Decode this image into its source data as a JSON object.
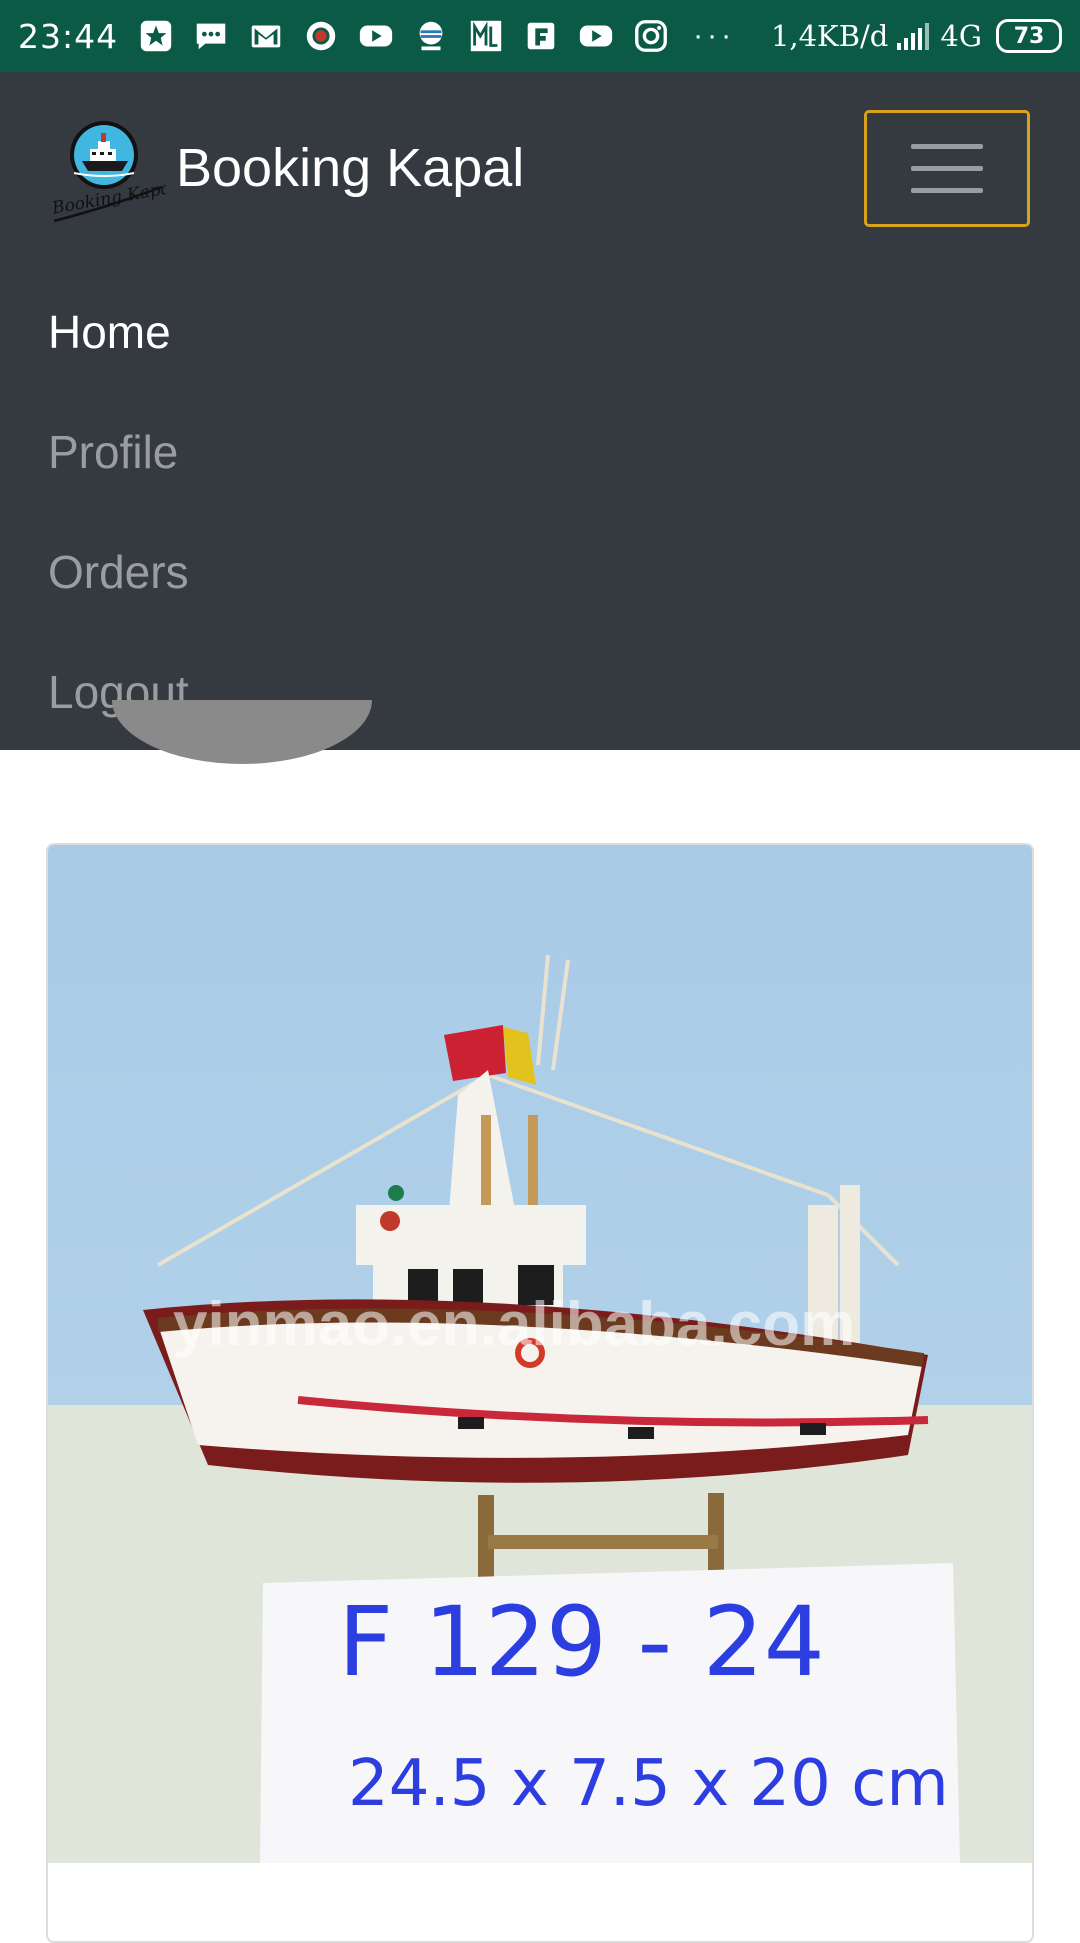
{
  "status_bar": {
    "time": "23:44",
    "icons": [
      "star-app-icon",
      "message-icon",
      "gmail-icon",
      "record-icon",
      "youtube-icon",
      "weather-icon",
      "ml-icon",
      "flipboard-icon",
      "youtube-icon",
      "instagram-icon"
    ],
    "more": "···",
    "network_speed": "1,4KB/d",
    "network_type": "4G",
    "battery": "73"
  },
  "navbar": {
    "brand_name": "Booking Kapal",
    "logo_caption": "Booking Kapal",
    "links": [
      {
        "label": "Home",
        "active": true
      },
      {
        "label": "Profile",
        "active": false
      },
      {
        "label": "Orders",
        "active": false
      },
      {
        "label": "Logout",
        "active": false
      }
    ],
    "toggler_border_color": "#d9a21a",
    "background": "#343a40"
  },
  "card": {
    "image": {
      "watermark": "yinmao.en.alibaba.com",
      "sign_line1": "F 129 - 24",
      "sign_line2": "24.5 x 7.5 x 20 cm"
    }
  }
}
